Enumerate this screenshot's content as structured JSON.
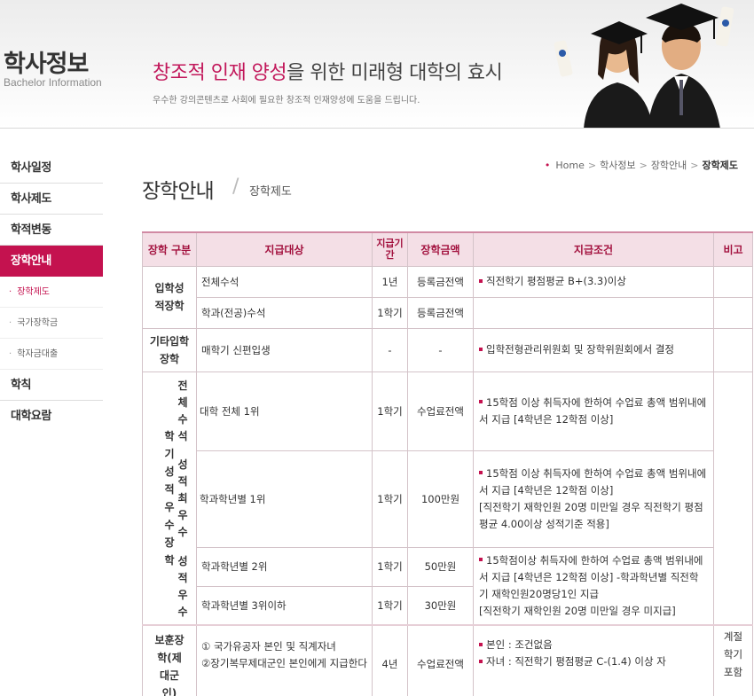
{
  "header": {
    "section_title": "학사정보",
    "section_sub": "Bachelor Information",
    "slogan_highlight": "창조적 인재 양성",
    "slogan_rest": "을 위한 미래형 대학의 효시",
    "slogan_sub": "우수한 강의콘텐츠로 사회에 필요한 창조적 인재양성에 도움을 드립니다."
  },
  "sidebar": {
    "items": [
      {
        "label": "학사일정"
      },
      {
        "label": "학사제도"
      },
      {
        "label": "학적변동"
      },
      {
        "label": "장학안내"
      },
      {
        "label": "학칙"
      },
      {
        "label": "대학요람"
      }
    ],
    "subitems": [
      {
        "label": "장학제도"
      },
      {
        "label": "국가장학금"
      },
      {
        "label": "학자금대출"
      }
    ]
  },
  "breadcrumb": {
    "home": "Home",
    "level1": "학사정보",
    "level2": "장학안내",
    "current": "장학제도"
  },
  "page": {
    "title": "장학안내",
    "subtitle": "장학제도"
  },
  "table": {
    "headers": {
      "type": "장학 구분",
      "target": "지급대상",
      "period": "지급기간",
      "amount": "장학금액",
      "condition": "지급조건",
      "note": "비고"
    },
    "admission": {
      "category": "입학성적장학",
      "rows": [
        {
          "target": "전체수석",
          "period": "1년",
          "amount": "등록금전액",
          "condition": "직전학기 평점평균 B+(3.3)이상"
        },
        {
          "target": "학과(전공)수석",
          "period": "1학기",
          "amount": "등록금전액"
        }
      ]
    },
    "other": {
      "category": "기타입학장학",
      "target": "매학기 신편입생",
      "period": "-",
      "amount": "-",
      "condition": "입학전형관리위원회 및 장학위원회에서 결정"
    },
    "grade": {
      "category": "학기성적우수장학",
      "sub1": "전체수석",
      "sub2": "성적최우수",
      "sub3": "성적우수",
      "r1_target": "대학 전체 1위",
      "r1_period": "1학기",
      "r1_amount": "수업료전액",
      "r1_cond": "15학점 이상 취득자에 한하여 수업료 총액 범위내에서 지급 [4학년은 12학점 이상]",
      "r2_target": "학과학년별 1위",
      "r2_period": "1학기",
      "r2_amount": "100만원",
      "r2_cond_1": "15학점 이상 취득자에 한하여 수업료 총액 범위내에서 지급 [4학년은 12학점 이상]",
      "r2_cond_2": "[직전학기 재학인원 20명 미만일 경우 직전학기 평점평균 4.00이상 성적기준 적용]",
      "r3_target": "학과학년별 2위",
      "r3_period": "1학기",
      "r3_amount": "50만원",
      "r4_target": "학과학년별 3위이하",
      "r4_period": "1학기",
      "r4_amount": "30만원",
      "r34_cond_1": "15학점이상 취득자에 한하여 수업료 총액 범위내에서 지급 [4학년은 12학점 이상] -학과학년별 직전학기 재학인원20명당1인 지급",
      "r34_cond_2": "[직전학기 재학인원 20명 미만일 경우 미지급]"
    },
    "veteran": {
      "category": "보훈장학(제대군인)",
      "target_1": "① 국가유공자 본인 및 직계자녀",
      "target_2": "②장기복무제대군인 본인에게 지급한다",
      "period": "4년",
      "amount": "수업료전액",
      "cond_1": "본인 : 조건없음",
      "cond_2": "자녀 : 직전학기 평점평균 C-(1.4) 이상 자",
      "note": "계절학기포함"
    }
  }
}
